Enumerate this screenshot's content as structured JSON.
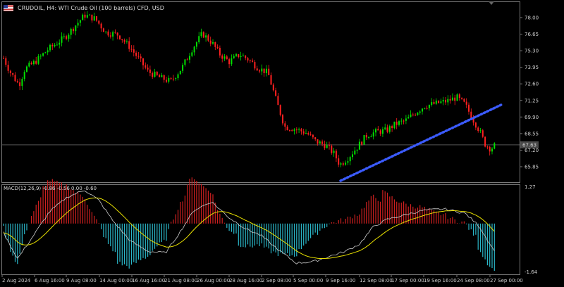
{
  "header": {
    "symbol_title": "CRUDOIL, H4: WTI Crude Oil (100 barrels) CFD, USD",
    "flag_icon": "us-flag-icon"
  },
  "price_axis": {
    "labels": [
      "78.00",
      "76.65",
      "75.30",
      "73.95",
      "72.60",
      "71.25",
      "69.90",
      "68.55",
      "67.20",
      "65.85"
    ],
    "current_price": "67.63"
  },
  "macd": {
    "title": "MACD(12,26,9) -0.86 -0.56 0.00 -0.60",
    "axis_labels": [
      "1.27",
      "-1.64"
    ]
  },
  "time_axis": {
    "labels": [
      "2 Aug 2024",
      "6 Aug 16:00",
      "9 Aug 08:00",
      "14 Aug 00:00",
      "16 Aug 16:00",
      "21 Aug 08:00",
      "26 Aug 00:00",
      "28 Aug 16:00",
      "2 Sep 08:00",
      "5 Sep 00:00",
      "9 Sep 16:00",
      "12 Sep 08:00",
      "17 Sep 00:00",
      "19 Sep 16:00",
      "24 Sep 08:00",
      "27 Sep 00:00"
    ]
  },
  "colors": {
    "bull": "#00e000",
    "bear": "#ff2020",
    "trendline": "#3b5bff",
    "macd_pos": "#d02020",
    "macd_neg": "#2ab7c9",
    "signal": "#e8e000",
    "macd_line": "#cccccc"
  }
}
